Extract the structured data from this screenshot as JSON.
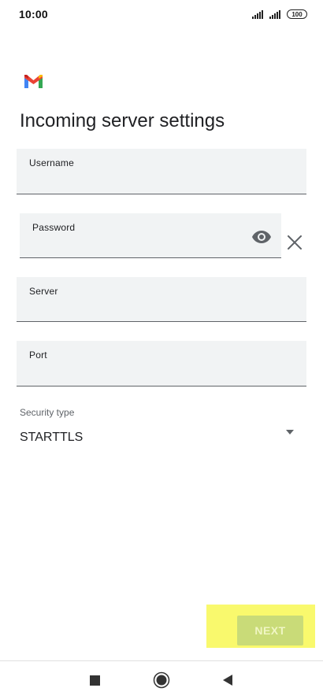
{
  "status_bar": {
    "time": "10:00",
    "battery": "100",
    "icons": [
      "signal-icon",
      "signal-icon",
      "battery-icon"
    ]
  },
  "app": {
    "logo": "gmail-logo",
    "title": "Incoming server settings"
  },
  "form": {
    "username": {
      "label": "Username",
      "value": ""
    },
    "password": {
      "label": "Password",
      "value": "",
      "visibility_icon": "eye-icon",
      "clear_icon": "close-icon"
    },
    "server": {
      "label": "Server",
      "value": ""
    },
    "port": {
      "label": "Port",
      "value": ""
    },
    "security_type": {
      "label": "Security type",
      "selected": "STARTTLS",
      "icon": "dropdown-arrow-icon"
    }
  },
  "actions": {
    "next_label": "NEXT",
    "highlight_color": "#f9f96d",
    "button_color": "#c9db78"
  },
  "nav_bar": {
    "icons": [
      "recents-icon",
      "home-icon",
      "back-icon"
    ]
  },
  "colors": {
    "field_bg": "#f1f3f4",
    "text": "#202124",
    "secondary_text": "#5f6368"
  }
}
